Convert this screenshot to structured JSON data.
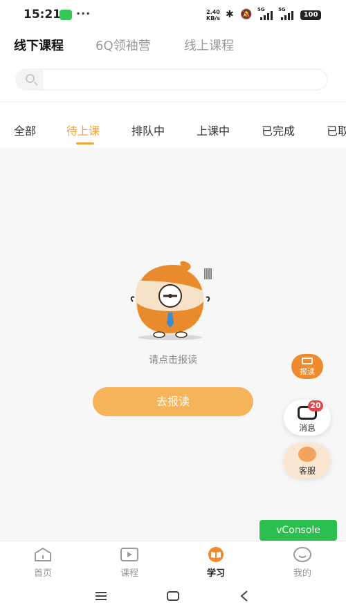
{
  "status_bar": {
    "time": "15:21",
    "more": "···",
    "net_speed_value": "2.40",
    "net_speed_unit": "KB/s",
    "signal_tag_1": "5G",
    "signal_tag_2": "5G",
    "battery": "100"
  },
  "top_tabs": [
    "线下课程",
    "6Q领袖营",
    "线上课程"
  ],
  "search": {
    "placeholder": ""
  },
  "sub_tabs": [
    "全部",
    "待上课",
    "排队中",
    "上课中",
    "已完成",
    "已取"
  ],
  "empty_state": {
    "message": "请点击报读",
    "button_label": "去报读"
  },
  "floating": {
    "report_label": "报读",
    "message_label": "消息",
    "message_badge": "20",
    "service_label": "客服"
  },
  "vconsole_label": "vConsole",
  "bottom_nav": [
    {
      "label": "首页",
      "icon": "home-icon",
      "active": false
    },
    {
      "label": "课程",
      "icon": "video-icon",
      "active": false
    },
    {
      "label": "学习",
      "icon": "book-icon",
      "active": true
    },
    {
      "label": "我的",
      "icon": "smile-icon",
      "active": false
    }
  ],
  "colors": {
    "accent": "#f0a43c",
    "cta": "#f5b35a",
    "report_fab": "#ef8a2e",
    "badge": "#e0484f",
    "vconsole": "#2cbf4f"
  }
}
